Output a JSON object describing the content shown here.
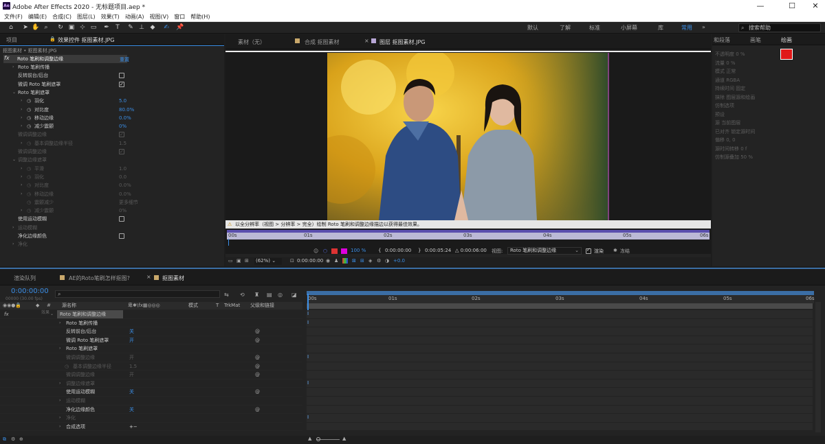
{
  "window": {
    "title": "Adobe After Effects 2020 - 无标题项目.aep *",
    "app_badge": "Ae",
    "min": "—",
    "max": "☐",
    "close": "✕"
  },
  "menu": [
    "文件(F)",
    "编辑(E)",
    "合成(C)",
    "图层(L)",
    "效果(T)",
    "动画(A)",
    "视图(V)",
    "窗口",
    "帮助(H)"
  ],
  "workspaces": [
    "默认",
    "了解",
    "标准",
    "小屏幕",
    "库",
    "常用"
  ],
  "active_workspace": "常用",
  "search_help": {
    "placeholder": "搜索帮助"
  },
  "left_panel": {
    "tab_project": "项目",
    "tab_effects": "效果控件 抠图素材.JPG",
    "breadcrumb": "抠图素材 • 抠图素材.JPG",
    "effect_name": "Roto 笔刷和调整边缘",
    "effect_reset": "重置",
    "rows": [
      {
        "label": "Roto 笔刷传播",
        "indent": 1,
        "tri": "›",
        "dim": false
      },
      {
        "label": "反转前台/后台",
        "indent": 1,
        "cb": "off",
        "dim": false
      },
      {
        "label": "微调 Roto 笔刷遮罩",
        "indent": 1,
        "cb": "on",
        "dim": false
      },
      {
        "label": "Roto 笔刷遮罩",
        "indent": 1,
        "tri": "⌄",
        "dim": false
      },
      {
        "label": "羽化",
        "indent": 2,
        "tri": "›",
        "stop": true,
        "value": "5.0",
        "dim": false
      },
      {
        "label": "对比度",
        "indent": 2,
        "tri": "›",
        "stop": true,
        "value": "80.0%",
        "dim": false
      },
      {
        "label": "移动边缘",
        "indent": 2,
        "tri": "›",
        "stop": true,
        "value": "0.0%",
        "dim": false
      },
      {
        "label": "减少震颤",
        "indent": 2,
        "tri": "›",
        "stop": true,
        "value": "0%",
        "dim": false
      },
      {
        "label": "微调调整边缘",
        "indent": 1,
        "cb": "on",
        "dim": true
      },
      {
        "label": "基本调整边缘半径",
        "indent": 2,
        "tri": "›",
        "stop": true,
        "value": "1.5",
        "dim": true
      },
      {
        "label": "微调调整边缘",
        "indent": 1,
        "cb": "on",
        "dim": true
      },
      {
        "label": "调整边缘遮罩",
        "indent": 1,
        "tri": "⌄",
        "dim": true
      },
      {
        "label": "平滑",
        "indent": 2,
        "tri": "›",
        "stop": true,
        "value": "1.0",
        "dim": true
      },
      {
        "label": "羽化",
        "indent": 2,
        "tri": "›",
        "stop": true,
        "value": "0.0",
        "dim": true
      },
      {
        "label": "对比度",
        "indent": 2,
        "tri": "›",
        "stop": true,
        "value": "0.0%",
        "dim": true
      },
      {
        "label": "移动边缘",
        "indent": 2,
        "tri": "›",
        "stop": true,
        "value": "0.0%",
        "dim": true
      },
      {
        "label": "震颤减少",
        "indent": 2,
        "stop": true,
        "value": "更多细节",
        "dim": true
      },
      {
        "label": "减少震颤",
        "indent": 2,
        "tri": "›",
        "stop": true,
        "value": "0%",
        "dim": true
      },
      {
        "label": "使用运动模糊",
        "indent": 1,
        "cb": "off",
        "dim": false
      },
      {
        "label": "运动模糊",
        "indent": 1,
        "tri": "›",
        "dim": true
      },
      {
        "label": "净化边缘颜色",
        "indent": 1,
        "cb": "off",
        "dim": false
      },
      {
        "label": "净化",
        "indent": 1,
        "tri": "›",
        "dim": true
      }
    ]
  },
  "viewer": {
    "tabs": [
      "素材（无）",
      "合成 抠图素材",
      "图层 抠图素材.JPG"
    ],
    "warning": "以全分辨率（视图 > 分辨率 > 完全）绘制 Roto 笔刷和调整边缘描边以获得最佳效果。",
    "ruler_ticks": [
      "00s",
      "01s",
      "02s",
      "03s",
      "04s",
      "05s",
      "06s"
    ],
    "zoom_pct": "100 %",
    "in_time": "0:00:00:00",
    "out_time": "0:00:05:24",
    "duration": "△ 0:00:06:00",
    "view_label": "视图:",
    "view_value": "Roto 笔刷和调整边缘",
    "render_label": "渲染",
    "freeze_label": "冻结",
    "magnification": "(62%)",
    "current_time": "0:00:00:00",
    "exposure": "+0.0"
  },
  "right_panel": {
    "tabs": [
      "和段落",
      "画笔",
      "绘画"
    ],
    "rows": [
      "不透明度  0 %",
      "流量  0 %",
      "模式  正常",
      "通道  RGBA",
      "持续时间  固定",
      "抹除  图层源和绘画",
      "仿制选项",
      "预设",
      "源  当前图层",
      "已对齐   锁定源时间",
      "偏移  0, 0",
      "源时间转移  0 f",
      "仿制源叠加  50 %"
    ]
  },
  "timeline": {
    "tabs": [
      "渲染队列",
      "AE的Roto笔刷怎样抠图?",
      "抠图素材"
    ],
    "timecode": "0:00:00:00",
    "timecode_sub": "00000 (30.00 fps)",
    "col_source": "源名称",
    "col_mode": "模式",
    "col_t": "T",
    "col_trkmat": "TrkMat",
    "col_parent": "父级和链接",
    "ruler_ticks": [
      "00s",
      "01s",
      "02s",
      "03s",
      "04s",
      "05s",
      "06s"
    ],
    "layer_label": "效果",
    "rows": [
      {
        "label": "Roto 笔刷和调整边缘",
        "indent": 0,
        "tri": "⌄",
        "dim": false,
        "sel": true,
        "fx": true
      },
      {
        "label": "Roto 笔刷传播",
        "indent": 1,
        "tri": "›",
        "dim": false
      },
      {
        "label": "反转前台/后台",
        "indent": 1,
        "value": "关",
        "sw": true,
        "dim": false
      },
      {
        "label": "微调 Roto 笔刷遮罩",
        "indent": 1,
        "value": "开",
        "sw": true,
        "dim": false
      },
      {
        "label": "Roto 笔刷遮罩",
        "indent": 1,
        "tri": "›",
        "dim": false
      },
      {
        "label": "微调调整边缘",
        "indent": 1,
        "value": "开",
        "sw": true,
        "dim": true
      },
      {
        "label": "基本调整边缘半径",
        "indent": 1,
        "stop": true,
        "value": "1.5",
        "sw": true,
        "dim": true
      },
      {
        "label": "微调调整边缘",
        "indent": 1,
        "value": "开",
        "sw": true,
        "dim": true
      },
      {
        "label": "调整边缘遮罩",
        "indent": 1,
        "tri": "›",
        "dim": true
      },
      {
        "label": "使用运动模糊",
        "indent": 1,
        "value": "关",
        "sw": true,
        "dim": false
      },
      {
        "label": "运动模糊",
        "indent": 1,
        "tri": "›",
        "dim": true
      },
      {
        "label": "净化边缘颜色",
        "indent": 1,
        "value": "关",
        "sw": true,
        "dim": false
      },
      {
        "label": "净化",
        "indent": 1,
        "tri": "›",
        "dim": true
      },
      {
        "label": "合成选项",
        "indent": 1,
        "tri": "›",
        "value": "+−",
        "dim": false
      }
    ]
  }
}
